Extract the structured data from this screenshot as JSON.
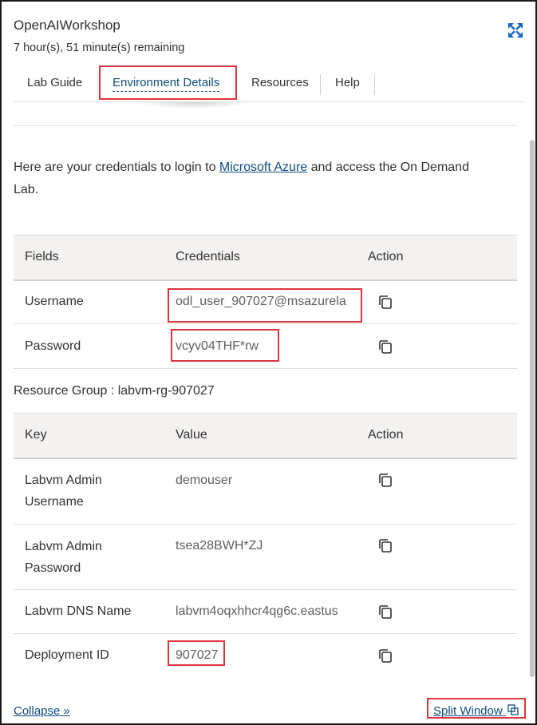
{
  "header": {
    "title": "OpenAIWorkshop",
    "timer": "7 hour(s), 51 minute(s) remaining",
    "expand_icon": "expand-arrows-icon"
  },
  "tabs": [
    {
      "label": "Lab Guide"
    },
    {
      "label": "Environment Details",
      "active": true
    },
    {
      "label": "Resources"
    },
    {
      "label": "Help"
    }
  ],
  "intro": {
    "before": "Here are your credentials to login to ",
    "link": "Microsoft Azure",
    "after": " and access the On Demand Lab."
  },
  "credentials": {
    "headers": [
      "Fields",
      "Credentials",
      "Action"
    ],
    "rows": [
      {
        "field": "Username",
        "value": "odl_user_907027@msazurela"
      },
      {
        "field": "Password",
        "value": "vcyv04THF*rw"
      }
    ]
  },
  "resource_group": "Resource Group : labvm-rg-907027",
  "resources": {
    "headers": [
      "Key",
      "Value",
      "Action"
    ],
    "rows": [
      {
        "key_line1": "Labvm Admin",
        "key_line2": "Username",
        "value": "demouser"
      },
      {
        "key_line1": "Labvm Admin",
        "key_line2": "Password",
        "value": "tsea28BWH*ZJ"
      },
      {
        "key_line1": "Labvm DNS Name",
        "key_line2": "",
        "value": "labvm4oqxhhcr4qg6c.eastus"
      },
      {
        "key_line1": "Deployment ID",
        "key_line2": "",
        "value": "907027"
      }
    ]
  },
  "footer": {
    "collapse": "Collapse »",
    "split_window": "Split Window"
  },
  "colors": {
    "link": "#0f4c81",
    "highlight": "#e0353d",
    "header_bg": "#f3f2f1"
  }
}
